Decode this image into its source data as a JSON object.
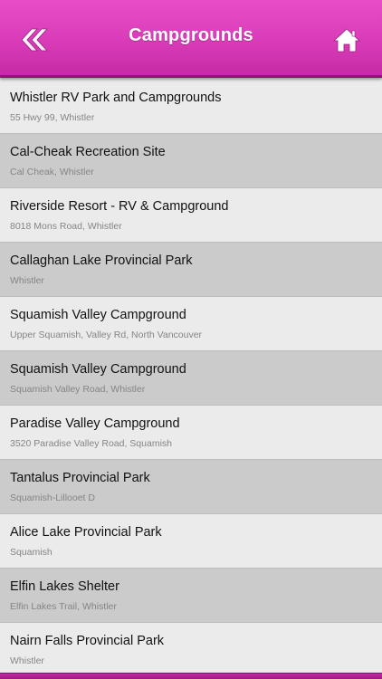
{
  "header": {
    "title": "Campgrounds",
    "back_icon": "double-chevron-left-icon",
    "home_icon": "home-icon",
    "colors": {
      "accent": "#d93bb8",
      "accent_dark": "#8c1676",
      "text": "#ffffff"
    }
  },
  "list": {
    "items": [
      {
        "name": "Whistler RV Park and Campgrounds",
        "address": "55 Hwy 99, Whistler"
      },
      {
        "name": "Cal-Cheak Recreation Site",
        "address": "Cal Cheak, Whistler"
      },
      {
        "name": "Riverside Resort - RV & Campground",
        "address": "8018 Mons Road, Whistler"
      },
      {
        "name": "Callaghan Lake Provincial Park",
        "address": "Whistler"
      },
      {
        "name": "Squamish Valley Campground",
        "address": "Upper Squamish, Valley Rd, North Vancouver"
      },
      {
        "name": "Squamish Valley Campground",
        "address": "Squamish Valley Road, Whistler"
      },
      {
        "name": "Paradise Valley Campground",
        "address": "3520 Paradise Valley Road, Squamish"
      },
      {
        "name": "Tantalus Provincial Park",
        "address": "Squamish-Lillooet D"
      },
      {
        "name": "Alice Lake Provincial Park",
        "address": "Squamish"
      },
      {
        "name": "Elfin Lakes Shelter",
        "address": "Elfin Lakes Trail, Whistler"
      },
      {
        "name": "Nairn Falls Provincial Park",
        "address": "Whistler"
      }
    ],
    "colors": {
      "row_light": "#ebebeb",
      "row_dark": "#cbcbcb",
      "name_text": "#111111",
      "address_text": "#858585"
    }
  }
}
